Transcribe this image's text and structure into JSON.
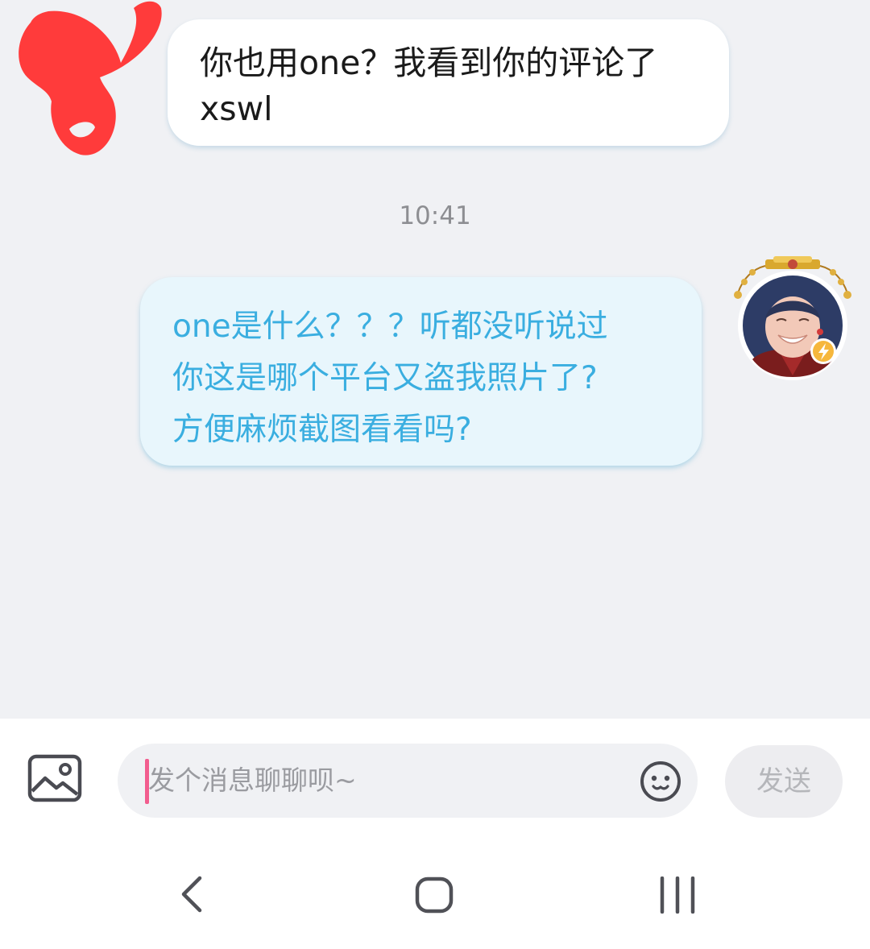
{
  "messages": {
    "incoming": {
      "text": "你也用one？我看到你的评论了\nxswl"
    },
    "timestamp": "10:41",
    "outgoing": {
      "text": "one是什么？？？听都没听说过\n你这是哪个平台又盗我照片了?\n方便麻烦截图看看吗?"
    }
  },
  "composer": {
    "placeholder": "发个消息聊聊呗~",
    "send_label": "发送",
    "image_icon": "image-icon",
    "emoji_icon": "emoji-icon"
  },
  "colors": {
    "incoming_text": "#1a1a1a",
    "outgoing_text": "#3aaee0",
    "outgoing_bubble": "#e8f6fc",
    "caret": "#f25d8e",
    "redaction": "#ff3b3b"
  }
}
